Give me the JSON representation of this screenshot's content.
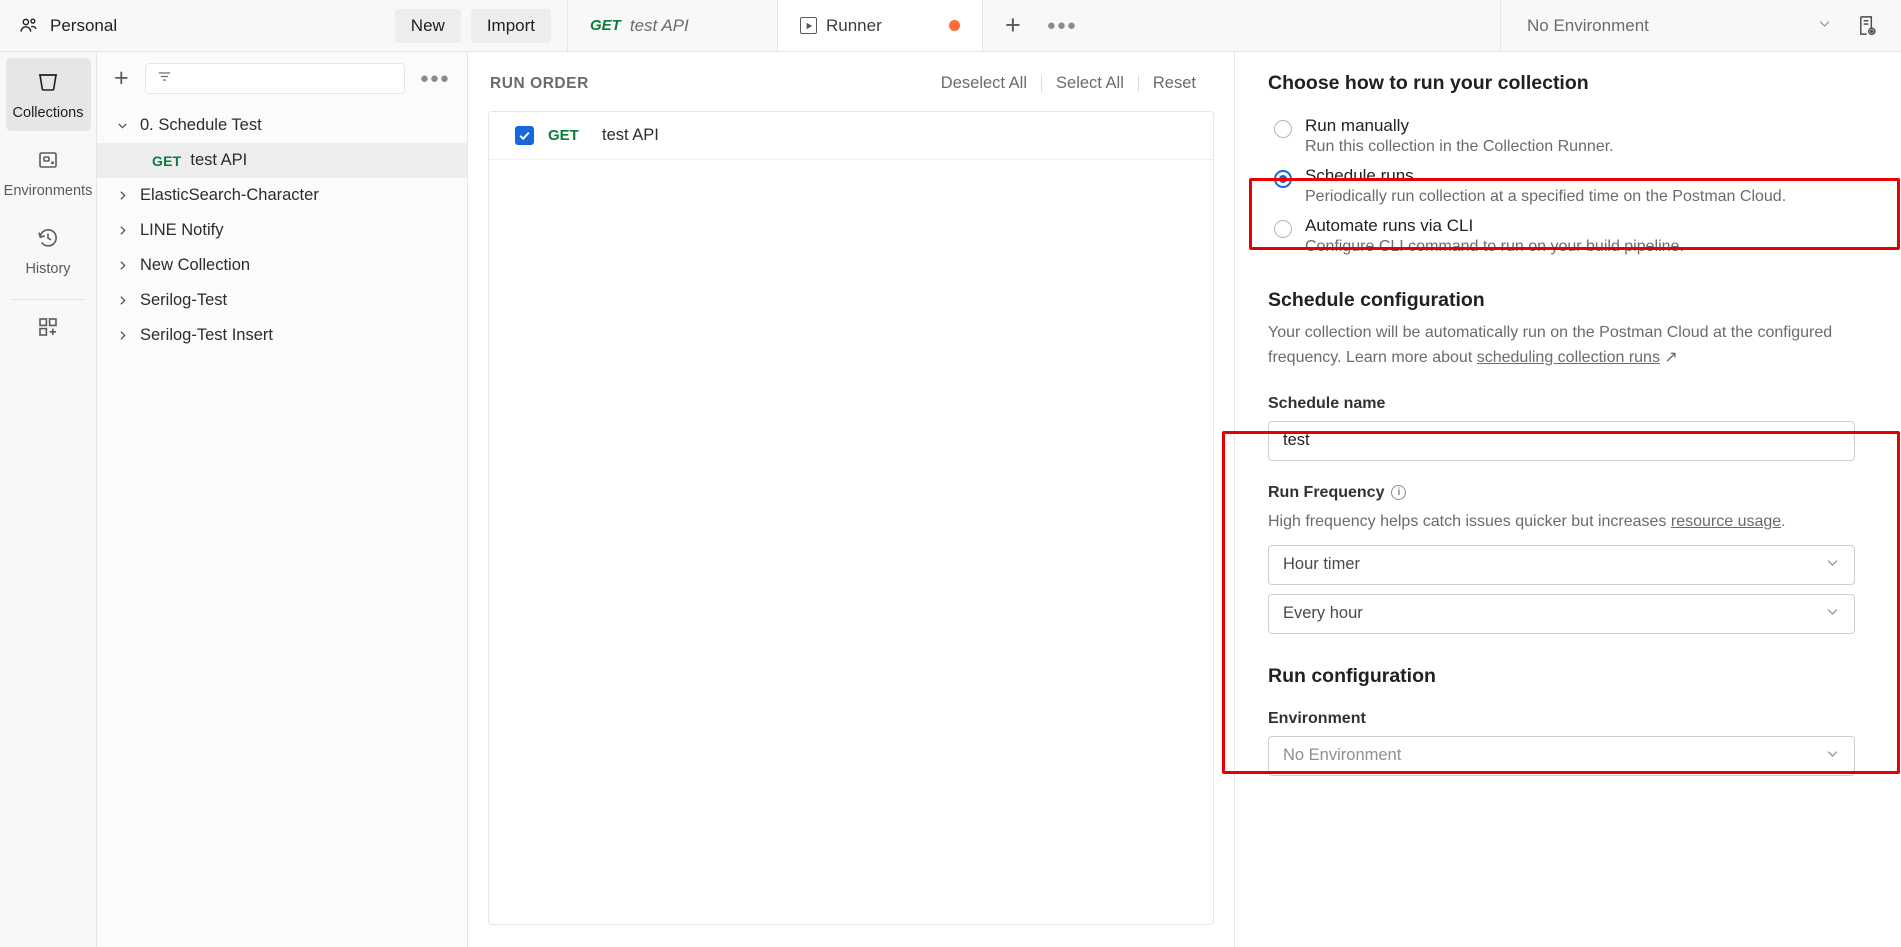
{
  "topbar": {
    "workspace": "Personal",
    "workspace_icon": "users-icon",
    "new_label": "New",
    "import_label": "Import",
    "tabs": [
      {
        "method": "GET",
        "label": "test API",
        "icon": "",
        "dirty": false
      },
      {
        "method": "",
        "label": "Runner",
        "icon": "play-icon",
        "dirty": true
      }
    ],
    "add_tab_icon": "plus-icon",
    "tab_options_icon": "ellipsis-icon",
    "environment_selected": "No Environment",
    "environment_chevron_icon": "chevron-down-icon",
    "env_quicklook_icon": "eye-document-icon"
  },
  "rail": {
    "items": [
      {
        "label": "Collections",
        "icon": "collections-icon",
        "active": true
      },
      {
        "label": "Environments",
        "icon": "environments-icon",
        "active": false
      },
      {
        "label": "History",
        "icon": "history-clock-icon",
        "active": false
      }
    ],
    "apps_icon": "add-modules-icon"
  },
  "sidebar": {
    "new_icon": "plus-icon",
    "filter_icon": "filter-icon",
    "filter_placeholder": "",
    "more_icon": "ellipsis-icon",
    "tree": [
      {
        "label": "0. Schedule Test",
        "type": "collection",
        "expanded": true,
        "selected": false
      },
      {
        "label": "test API",
        "type": "request",
        "method": "GET",
        "selected": true
      },
      {
        "label": "ElasticSearch-Character",
        "type": "collection",
        "expanded": false,
        "selected": false
      },
      {
        "label": "LINE Notify",
        "type": "collection",
        "expanded": false,
        "selected": false
      },
      {
        "label": "New Collection",
        "type": "collection",
        "expanded": false,
        "selected": false
      },
      {
        "label": "Serilog-Test",
        "type": "collection",
        "expanded": false,
        "selected": false
      },
      {
        "label": "Serilog-Test Insert",
        "type": "collection",
        "expanded": false,
        "selected": false
      }
    ]
  },
  "run_order": {
    "title": "RUN ORDER",
    "deselect_all": "Deselect All",
    "select_all": "Select All",
    "reset": "Reset",
    "items": [
      {
        "method": "GET",
        "name": "test API",
        "checked": true
      }
    ]
  },
  "right_panel": {
    "choose_heading": "Choose how to run your collection",
    "run_modes": [
      {
        "title": "Run manually",
        "subtitle": "Run this collection in the Collection Runner.",
        "selected": false
      },
      {
        "title": "Schedule runs",
        "subtitle": "Periodically run collection at a specified time on the Postman Cloud.",
        "selected": true
      },
      {
        "title": "Automate runs via CLI",
        "subtitle": "Configure CLI command to run on your build pipeline.",
        "selected": false
      }
    ],
    "schedule_config": {
      "heading": "Schedule configuration",
      "description_a": "Your collection will be automatically run on the Postman Cloud at the configured frequency. Learn more about ",
      "description_link": "scheduling collection runs",
      "description_link_arrow": "↗",
      "name_label": "Schedule name",
      "name_value": "test",
      "name_placeholder": "Schedule name",
      "frequency_label": "Run Frequency",
      "frequency_info_icon": "info-icon",
      "frequency_helper_a": "High frequency helps catch issues quicker but increases ",
      "frequency_helper_link": "resource usage",
      "frequency_helper_b": ".",
      "timer_value": "Hour timer",
      "interval_value": "Every hour",
      "chevron_icon": "chevron-down-icon"
    },
    "run_config": {
      "heading": "Run configuration",
      "environment_label": "Environment",
      "environment_value": "No Environment",
      "chevron_icon": "chevron-down-icon"
    }
  },
  "annotations": {
    "highlight_color": "#e60000",
    "boxes": [
      {
        "name": "schedule-runs-highlight"
      },
      {
        "name": "schedule-configuration-highlight"
      }
    ]
  }
}
